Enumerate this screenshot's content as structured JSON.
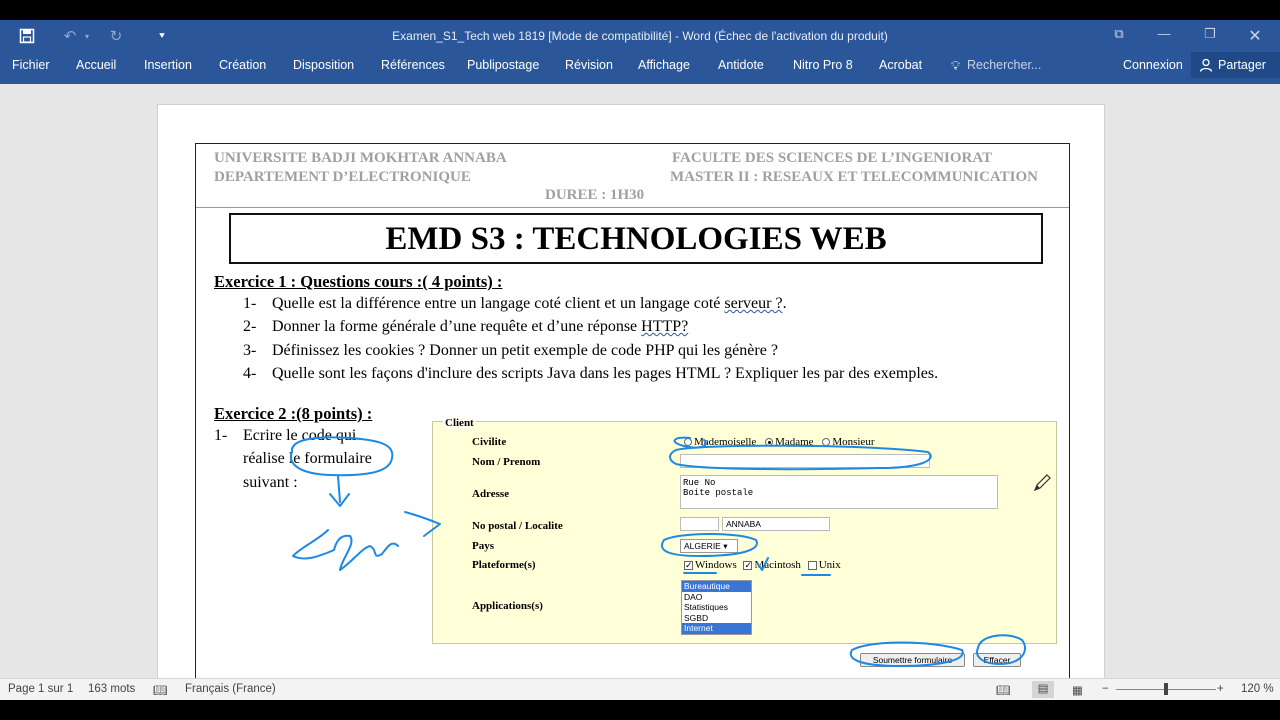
{
  "window": {
    "title": "Examen_S1_Tech web 1819 [Mode de compatibilité] - Word (Échec de l'activation du produit)"
  },
  "qat": {
    "save_icon": "save-icon",
    "undo_icon": "undo-icon",
    "redo_icon": "redo-icon",
    "customize_icon": "customize-qat-icon"
  },
  "ribbon": {
    "tabs": [
      "Fichier",
      "Accueil",
      "Insertion",
      "Création",
      "Disposition",
      "Références",
      "Publipostage",
      "Révision",
      "Affichage",
      "Antidote",
      "Nitro Pro 8",
      "Acrobat"
    ],
    "search": "Rechercher...",
    "signin": "Connexion",
    "share": "Partager"
  },
  "document": {
    "header_left_1": "UNIVERSITE BADJI MOKHTAR ANNABA",
    "header_left_2": "DEPARTEMENT D’ELECTRONIQUE",
    "header_right_1": "FACULTE DES SCIENCES DE L’INGENIORAT",
    "header_right_2": "MASTER II : RESEAUX ET TELECOMMUNICATION",
    "duration": "DUREE : 1H30",
    "title": "EMD S3 : TECHNOLOGIES WEB",
    "ex1_title": "Exercice 1 : Questions cours :( 4 points) :",
    "questions": [
      {
        "num": "1-",
        "text_a": "Quelle est la différence entre un langage coté client et un langage coté ",
        "text_b": "serveur ?",
        "text_c": "."
      },
      {
        "num": "2-",
        "text_a": "Donner la forme générale d’une requête et d’une réponse ",
        "text_b": "HTTP?",
        "text_c": ""
      },
      {
        "num": "3-",
        "text": "Définissez les cookies ? Donner un petit exemple de code PHP qui les génère ?"
      },
      {
        "num": "4-",
        "text": "Quelle sont les façons d'inclure des scripts Java dans les pages HTML ? Expliquer les par des exemples."
      }
    ],
    "ex2_title": "Exercice 2 :(8 points) :",
    "ex2_num": "1-",
    "ex2_line1": "Ecrire le code qui",
    "ex2_line2": "réalise le formulaire",
    "ex2_line3": "suivant :"
  },
  "form": {
    "legend": "Client",
    "labels": {
      "civilite": "Civilite",
      "nom": "Nom / Prenom",
      "adresse": "Adresse",
      "postal": "No postal / Localite",
      "pays": "Pays",
      "plateforme": "Plateforme(s)",
      "applications": "Applications(s)"
    },
    "civilite_options": [
      "Mademoiselle",
      "Madame",
      "Monsieur"
    ],
    "civilite_selected": "Madame",
    "adresse_value": "Rue No\nBoite postale",
    "localite_value": "ANNABA",
    "pays_value": "ALGERIE",
    "platforms": [
      {
        "label": "Windows",
        "checked": true
      },
      {
        "label": "Macintosh",
        "checked": true
      },
      {
        "label": "Unix",
        "checked": false
      }
    ],
    "applications": [
      "Bureautique",
      "DAO",
      "Statistiques",
      "SGBD",
      "Internet"
    ],
    "applications_selected": [
      "Bureautique",
      "Internet"
    ],
    "submit": "Soumettre formulaire",
    "reset": "Effacer"
  },
  "status": {
    "page": "Page 1 sur 1",
    "words": "163 mots",
    "language": "Français (France)",
    "zoom": "120 %"
  },
  "colors": {
    "word_blue": "#2b579a",
    "ink_blue": "#1e88e5",
    "form_bg": "#ffffd8"
  }
}
